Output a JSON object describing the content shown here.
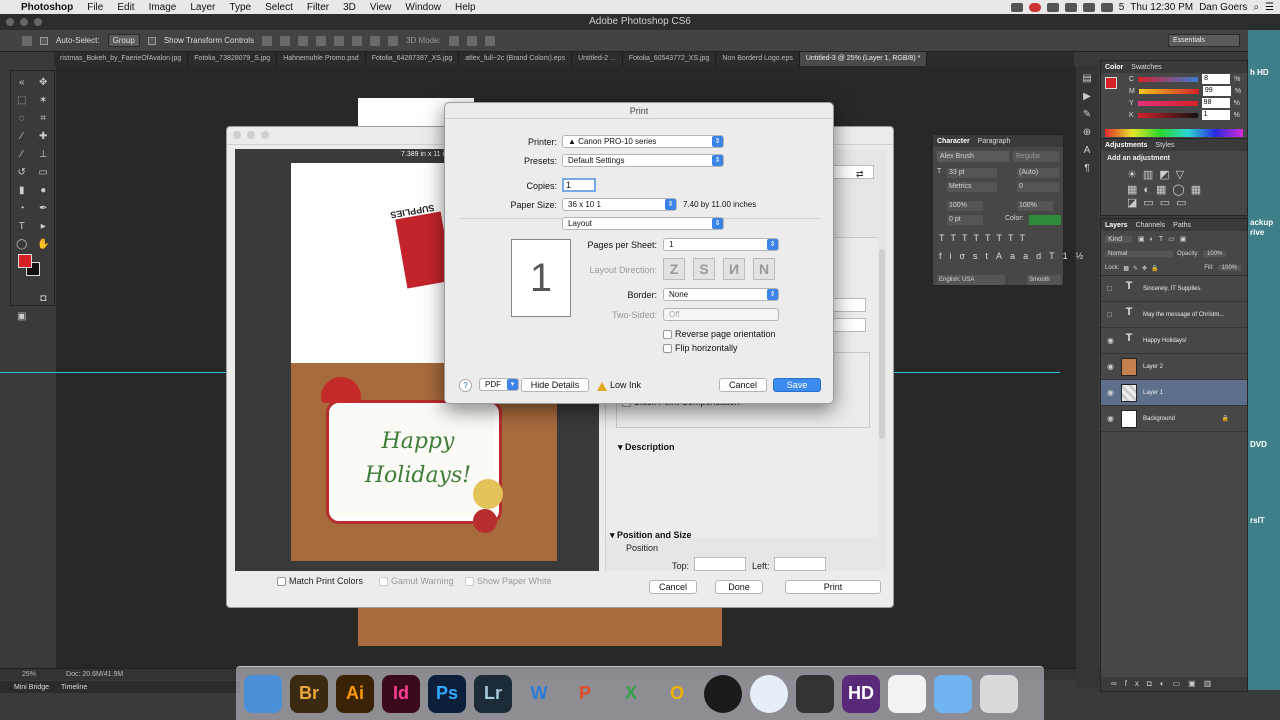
{
  "menubar": {
    "app": "Photoshop",
    "items": [
      "File",
      "Edit",
      "Image",
      "Layer",
      "Type",
      "Select",
      "Filter",
      "3D",
      "View",
      "Window",
      "Help"
    ],
    "battery": "5",
    "clock": "Thu 12:30 PM",
    "user": "Dan Goers"
  },
  "window": {
    "title": "Adobe Photoshop CS6"
  },
  "options": {
    "auto_select": "Auto-Select:",
    "group": "Group",
    "show_transform": "Show Transform Controls",
    "mode_3d": "3D Mode:",
    "workspace": "Essentials"
  },
  "tabs": [
    "ristmas_Bokeh_by_FaerieOfAvalon.jpg",
    "Fotolia_73828079_S.jpg",
    "Hahnemuhle Promo.psd",
    "Fotolia_64287387_XS.jpg",
    "atlex_full~2c (Brand Colors).eps",
    "Untitled-2 ...",
    "Fotolia_60543772_XS.jpg",
    "Non Borderd Logo.eps",
    "Untitled-3 @ 25% (Layer 1, RGB/8) *"
  ],
  "status": {
    "zoom": "25%",
    "doc": "Doc: 20.6M/41.9M"
  },
  "bottom_tabs": [
    "Mini Bridge",
    "Timeline"
  ],
  "color_panel": {
    "tabs": [
      "Color",
      "Swatches"
    ],
    "channels": [
      {
        "label": "C",
        "value": "8"
      },
      {
        "label": "M",
        "value": "99"
      },
      {
        "label": "Y",
        "value": "98"
      },
      {
        "label": "K",
        "value": "1"
      }
    ],
    "pct": "%"
  },
  "char_panel": {
    "tabs": [
      "Character",
      "Paragraph"
    ],
    "font": "Alex Brush",
    "style": "Regular",
    "size": "33 pt",
    "leading": "(Auto)",
    "kerning": "Metrics",
    "tracking": "0",
    "vscale": "100%",
    "hscale": "100%",
    "baseline": "0 pt",
    "color_label": "Color:",
    "language": "English: USA",
    "aa": "Smooth"
  },
  "adjust_panel": {
    "tabs": [
      "Adjustments",
      "Styles"
    ],
    "hint": "Add an adjustment"
  },
  "layers_panel": {
    "tabs": [
      "Layers",
      "Channels",
      "Paths"
    ],
    "kind": "Kind",
    "blend": "Normal",
    "opacity_label": "Opacity:",
    "opacity": "100%",
    "lock_label": "Lock:",
    "fill_label": "Fill:",
    "fill": "100%",
    "layers": [
      {
        "name": "Sincerely, IT Supplies",
        "type": "T",
        "visible": false,
        "selected": false
      },
      {
        "name": "May the message of Christm...",
        "type": "T",
        "visible": false,
        "selected": false
      },
      {
        "name": "Happy Holidays!",
        "type": "T",
        "visible": true,
        "selected": false
      },
      {
        "name": "Layer 2",
        "type": "img",
        "visible": true,
        "selected": false
      },
      {
        "name": "Layer 1",
        "type": "img",
        "visible": true,
        "selected": true
      },
      {
        "name": "Background",
        "type": "bg",
        "visible": true,
        "selected": false
      }
    ]
  },
  "ps_print": {
    "preview_size": "7.389 in x 11 in",
    "card_line1": "Happy",
    "card_line2": "Holidays!",
    "logo_text": "SUPPLIES",
    "match_colors": "Match Print Colors",
    "gamut_warning": "Gamut Warning",
    "show_paper_white": "Show Paper White",
    "bpc": "Black Point Compensation",
    "description": "Description",
    "position_size": "Position and Size",
    "position": "Position",
    "top": "Top:",
    "left": "Left:",
    "cancel": "Cancel",
    "done": "Done",
    "print": "Print"
  },
  "mac_print": {
    "title": "Print",
    "printer_label": "Printer:",
    "printer": "Canon PRO-10 series",
    "presets_label": "Presets:",
    "presets": "Default Settings",
    "copies_label": "Copies:",
    "copies": "1",
    "paper_label": "Paper Size:",
    "paper": "36 x 10 1",
    "paper_dims": "7.40 by 11.00 inches",
    "section": "Layout",
    "page_num": "1",
    "pps_label": "Pages per Sheet:",
    "pps": "1",
    "ld_label": "Layout Direction:",
    "border_label": "Border:",
    "border": "None",
    "two_sided_label": "Two-Sided:",
    "two_sided": "Off",
    "reverse": "Reverse page orientation",
    "flip": "Flip horizontally",
    "help": "?",
    "pdf": "PDF",
    "hide_details": "Hide Details",
    "low_ink": "Low Ink",
    "cancel": "Cancel",
    "save": "Save"
  },
  "dock": {
    "apps": [
      {
        "name": "finder",
        "label": "",
        "bg": "#4a90d9",
        "fg": "#fff"
      },
      {
        "name": "bridge",
        "label": "Br",
        "bg": "#3a2a12",
        "fg": "#e8a63a"
      },
      {
        "name": "illustrator",
        "label": "Ai",
        "bg": "#3a2305",
        "fg": "#ff9a00"
      },
      {
        "name": "indesign",
        "label": "Id",
        "bg": "#3c0a1e",
        "fg": "#fd3f93"
      },
      {
        "name": "photoshop",
        "label": "Ps",
        "bg": "#0c1f3a",
        "fg": "#31a8ff"
      },
      {
        "name": "lightroom",
        "label": "Lr",
        "bg": "#1c2b35",
        "fg": "#a8c8dc"
      },
      {
        "name": "word",
        "label": "W",
        "bg": "transparent",
        "fg": "#2b79d8"
      },
      {
        "name": "powerpoint",
        "label": "P",
        "bg": "transparent",
        "fg": "#e04b28"
      },
      {
        "name": "excel",
        "label": "X",
        "bg": "transparent",
        "fg": "#33a04a"
      },
      {
        "name": "outlook",
        "label": "O",
        "bg": "transparent",
        "fg": "#f0b400"
      },
      {
        "name": "spotify",
        "label": "",
        "bg": "#1a1a1a",
        "fg": "#1db954"
      },
      {
        "name": "safari",
        "label": "",
        "bg": "#e6eef8",
        "fg": "#2a6fd0"
      },
      {
        "name": "printer",
        "label": "",
        "bg": "#333",
        "fg": "#ccc"
      },
      {
        "name": "hd-app",
        "label": "HD",
        "bg": "#5a2a7a",
        "fg": "#fff"
      },
      {
        "name": "documents",
        "label": "",
        "bg": "#f2f2f2",
        "fg": "#555"
      },
      {
        "name": "folder",
        "label": "",
        "bg": "#6fb3f0",
        "fg": "#fff"
      },
      {
        "name": "trash",
        "label": "",
        "bg": "#dadada",
        "fg": "#888"
      }
    ]
  },
  "desktop": {
    "labels": [
      "h HD",
      "ackup",
      "rive",
      "DVD",
      "rsIT"
    ]
  }
}
